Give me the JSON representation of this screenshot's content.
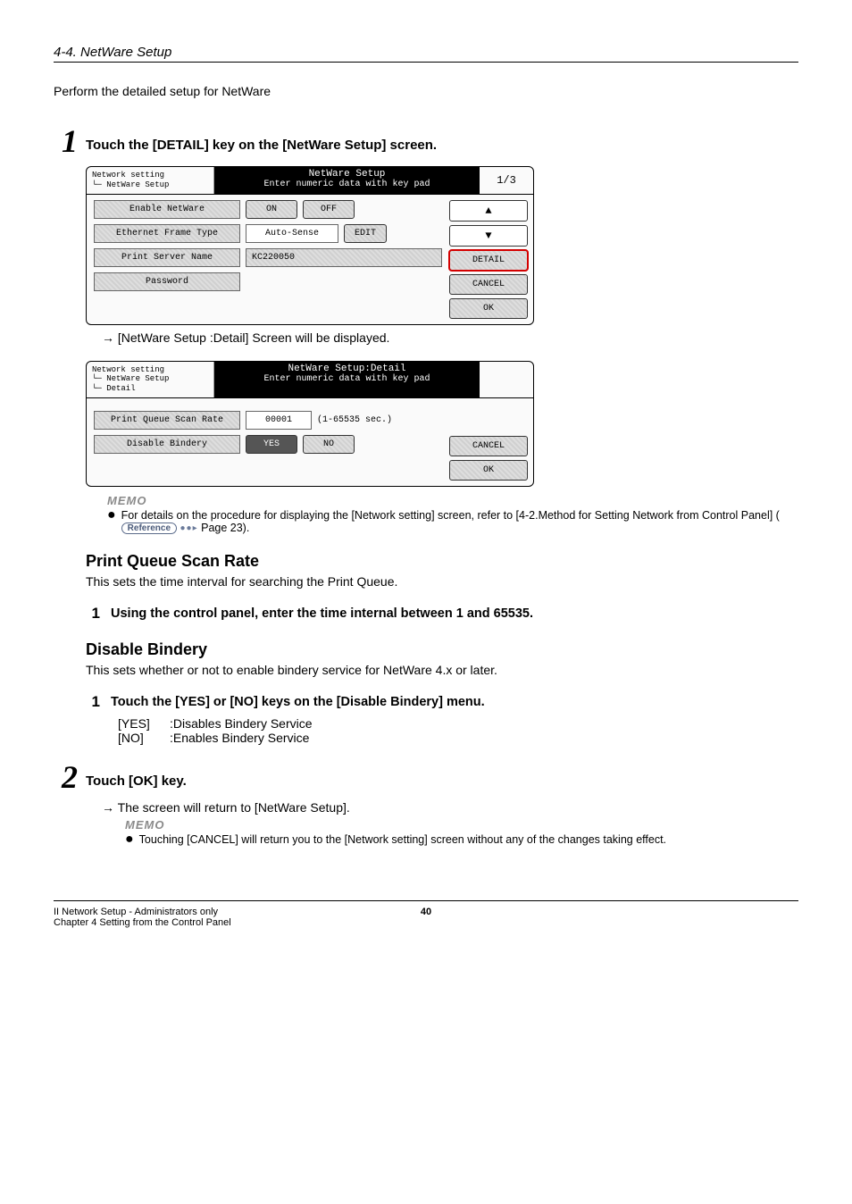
{
  "header": "4-4. NetWare Setup",
  "intro": "Perform the detailed setup for NetWare",
  "step1": {
    "num": "1",
    "text": "Touch the [DETAIL] key on the [NetWare Setup] screen."
  },
  "screen1": {
    "breadcrumb": {
      "l1": "Network setting",
      "l2": "└─ NetWare Setup"
    },
    "title": "NetWare Setup",
    "subtitle": "Enter numeric data with key pad",
    "page": "1/3",
    "rows": {
      "enable": {
        "label": "Enable NetWare",
        "on": "ON",
        "off": "OFF"
      },
      "frame": {
        "label": "Ethernet Frame Type",
        "value": "Auto-Sense",
        "edit": "EDIT"
      },
      "server": {
        "label": "Print Server Name",
        "value": "KC220050"
      },
      "password": {
        "label": "Password"
      }
    },
    "side": {
      "up": "▲",
      "down": "▼",
      "detail": "DETAIL",
      "cancel": "CANCEL",
      "ok": "OK"
    }
  },
  "result1": "[NetWare Setup :Detail] Screen will be displayed.",
  "screen2": {
    "breadcrumb": {
      "l1": "Network setting",
      "l2": "└─ NetWare Setup",
      "l3": "    └─ Detail"
    },
    "title": "NetWare Setup:Detail",
    "subtitle": "Enter numeric data with key pad",
    "rows": {
      "rate": {
        "label": "Print Queue Scan Rate",
        "value": "00001",
        "hint": "(1-65535 sec.)"
      },
      "bindery": {
        "label": "Disable Bindery",
        "yes": "YES",
        "no": "NO"
      }
    },
    "side": {
      "cancel": "CANCEL",
      "ok": "OK"
    }
  },
  "memo1": {
    "title": "MEMO",
    "text_a": "For details on the procedure for displaying the [Network setting] screen, refer to [4-2.Method for Setting Network from Control Panel] (",
    "ref": "Reference",
    "text_b": "  Page 23)."
  },
  "scanrate": {
    "heading": "Print Queue Scan Rate",
    "desc": "This sets the time interval for searching the Print Queue.",
    "step_num": "1",
    "step_text": "Using the control panel, enter the time internal between 1 and 65535."
  },
  "bindery": {
    "heading": "Disable Bindery",
    "desc": "This sets whether or not to enable bindery service for NetWare 4.x or later.",
    "step_num": "1",
    "step_text": "Touch the [YES] or [NO] keys on the [Disable Bindery] menu.",
    "opts": {
      "yes_key": "[YES]",
      "yes_desc": ":Disables Bindery Service",
      "no_key": "[NO]",
      "no_desc": ":Enables Bindery Service"
    }
  },
  "step2": {
    "num": "2",
    "text": "Touch [OK] key.",
    "result": "The screen will return to [NetWare Setup].",
    "memo_title": "MEMO",
    "memo_text": "Touching [CANCEL] will return you to the [Network setting] screen without any of the changes taking effect."
  },
  "footer": {
    "line1": "II Network Setup - Administrators only",
    "line2": "Chapter 4 Setting from the Control Panel",
    "page": "40"
  }
}
